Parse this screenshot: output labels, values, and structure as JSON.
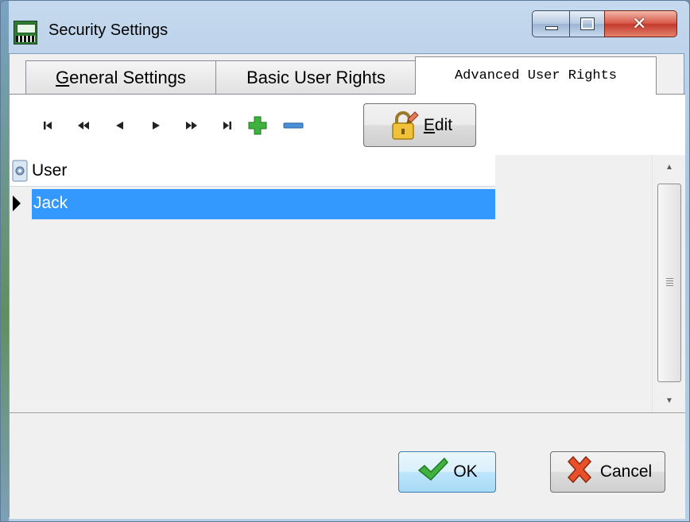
{
  "window": {
    "title": "Security Settings",
    "app_icon": "app-icon",
    "controls": [
      "minimize-icon",
      "maximize-icon",
      "close-icon"
    ]
  },
  "tabs": [
    {
      "label": "General Settings",
      "mnemonic": "G",
      "rest": "eneral Settings",
      "active": false
    },
    {
      "label": "Basic User Rights",
      "active": false
    },
    {
      "label": "Advanced User Rights",
      "active": true
    }
  ],
  "toolbar": {
    "nav_icons": [
      "first-record-icon",
      "prior-page-icon",
      "prior-record-icon",
      "next-record-icon",
      "next-page-icon",
      "last-record-icon",
      "add-record-icon",
      "delete-record-icon"
    ],
    "edit_button": {
      "label": "Edit",
      "mnemonic": "E",
      "rest": "dit",
      "icon": "lock-edit-icon"
    }
  },
  "grid": {
    "header_icon": "gear-icon",
    "columns": [
      "User"
    ],
    "rows": [
      {
        "user": "Jack",
        "selected": true
      }
    ],
    "selection_color": "#3399ff"
  },
  "buttons": {
    "ok": {
      "label": "OK",
      "icon": "checkmark-icon",
      "icon_color": "#3fb13f"
    },
    "cancel": {
      "label": "Cancel",
      "icon": "x-icon",
      "icon_color": "#e8502a"
    }
  }
}
